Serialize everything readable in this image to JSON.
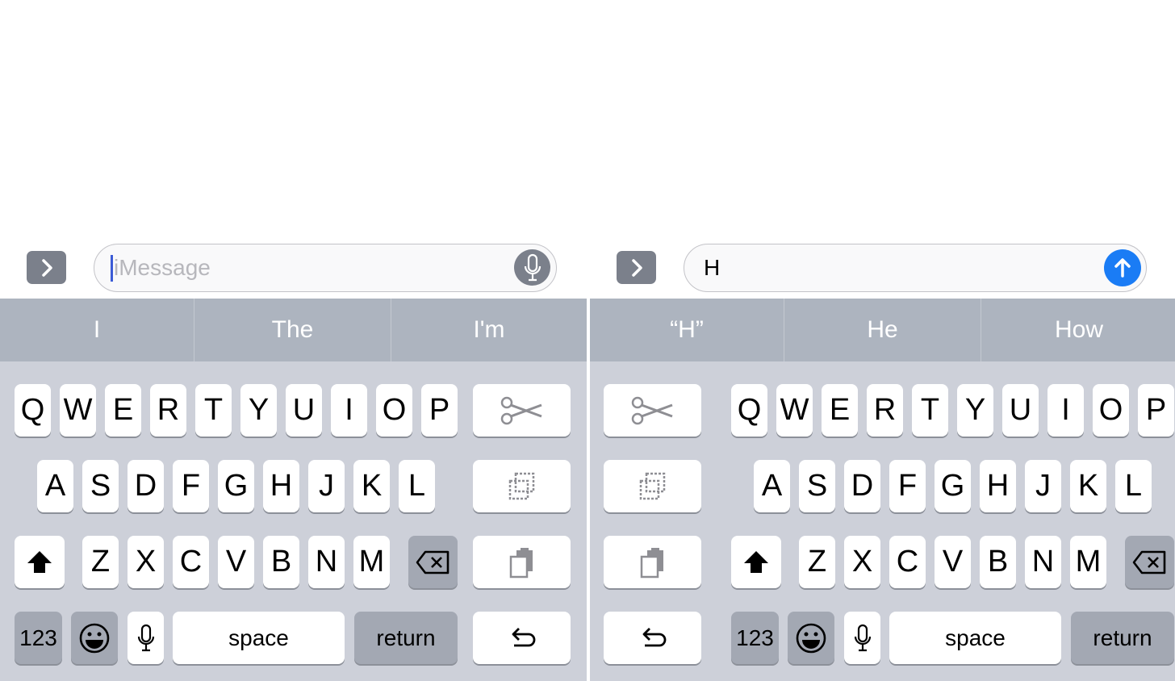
{
  "left": {
    "message_field": {
      "placeholder": "iMessage",
      "value": ""
    },
    "predictions": [
      "I",
      "The",
      "I'm"
    ],
    "rows": {
      "row1": [
        "Q",
        "W",
        "E",
        "R",
        "T",
        "Y",
        "U",
        "I",
        "O",
        "P"
      ],
      "row2": [
        "A",
        "S",
        "D",
        "F",
        "G",
        "H",
        "J",
        "K",
        "L"
      ],
      "row3": [
        "Z",
        "X",
        "C",
        "V",
        "B",
        "N",
        "M"
      ]
    },
    "numbers_label": "123",
    "space_label": "space",
    "return_label": "return"
  },
  "right": {
    "message_field": {
      "placeholder": "",
      "value": "H"
    },
    "predictions": [
      "“H”",
      "He",
      "How"
    ],
    "rows": {
      "row1": [
        "Q",
        "W",
        "E",
        "R",
        "T",
        "Y",
        "U",
        "I",
        "O",
        "P"
      ],
      "row2": [
        "A",
        "S",
        "D",
        "F",
        "G",
        "H",
        "J",
        "K",
        "L"
      ],
      "row3": [
        "Z",
        "X",
        "C",
        "V",
        "B",
        "N",
        "M"
      ]
    },
    "numbers_label": "123",
    "space_label": "space",
    "return_label": "return"
  },
  "icons": {
    "expand": "chevron-right-icon",
    "dictation": "microphone-icon",
    "send": "arrow-up-icon",
    "cut": "scissors-icon",
    "copy": "copy-icon",
    "paste": "paste-icon",
    "undo": "undo-icon",
    "shift": "shift-icon",
    "delete": "backspace-icon",
    "emoji": "emoji-icon"
  },
  "colors": {
    "send_button": "#1a7cf5",
    "keyboard_bg": "#cdd0d9",
    "prediction_bar": "#adb4bf",
    "caret": "#3b5bd6"
  }
}
